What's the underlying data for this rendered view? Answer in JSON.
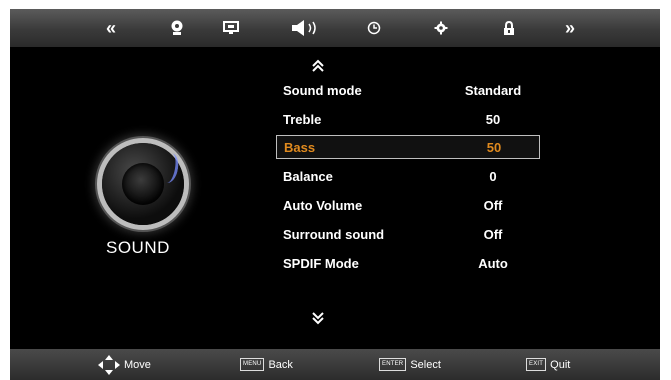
{
  "top_icons": [
    {
      "name": "prev-page-icon",
      "glyph": "«"
    },
    {
      "name": "picture-icon",
      "glyph": ""
    },
    {
      "name": "screen-icon",
      "glyph": ""
    },
    {
      "name": "sound-icon",
      "glyph": ""
    },
    {
      "name": "time-icon",
      "glyph": ""
    },
    {
      "name": "setup-icon",
      "glyph": ""
    },
    {
      "name": "lock-icon",
      "glyph": ""
    },
    {
      "name": "next-page-icon",
      "glyph": "»"
    }
  ],
  "panel": {
    "title": "SOUND",
    "icon": "speaker-icon"
  },
  "menu": {
    "items": [
      {
        "label": "Sound mode",
        "value": "Standard"
      },
      {
        "label": "Treble",
        "value": "50"
      },
      {
        "label": "Bass",
        "value": "50",
        "selected": true
      },
      {
        "label": "Balance",
        "value": "0"
      },
      {
        "label": "Auto Volume",
        "value": "Off"
      },
      {
        "label": "Surround sound",
        "value": "Off"
      },
      {
        "label": "SPDIF Mode",
        "value": "Auto"
      }
    ]
  },
  "footer": {
    "move": "Move",
    "menu_key": "MENU",
    "back": "Back",
    "enter_key": "ENTER",
    "select": "Select",
    "exit_key": "EXIT",
    "quit": "Quit"
  },
  "colors": {
    "highlight": "#e08a1e",
    "background": "#000000",
    "bar": "#3a3a3a"
  }
}
